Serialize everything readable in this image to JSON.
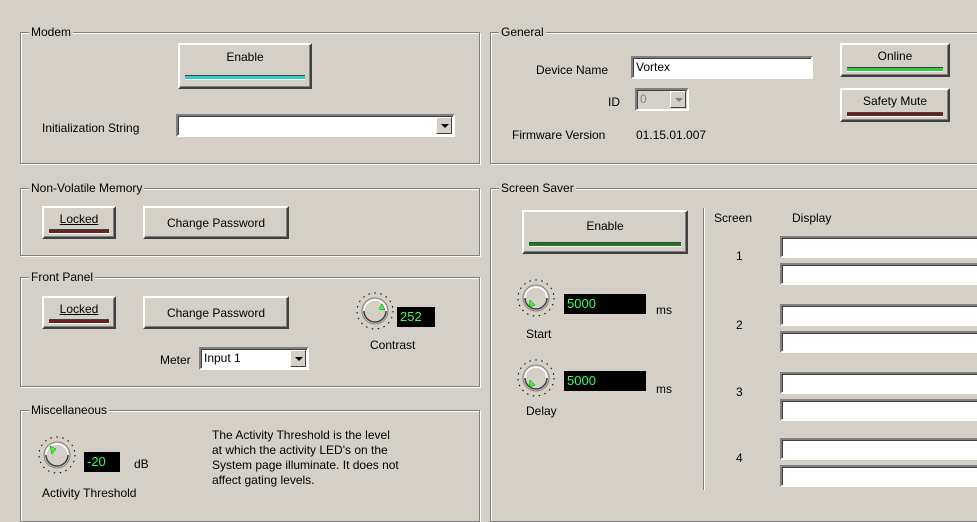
{
  "modem": {
    "title": "Modem",
    "enable_label": "Enable",
    "init_label": "Initialization String",
    "init_value": ""
  },
  "nvm": {
    "title": "Non-Volatile Memory",
    "locked_label": "Locked",
    "change_password_label": "Change Password"
  },
  "front_panel": {
    "title": "Front Panel",
    "locked_label": "Locked",
    "change_password_label": "Change Password",
    "contrast_value": "252",
    "contrast_label": "Contrast",
    "meter_label": "Meter",
    "meter_value": "Input 1"
  },
  "misc": {
    "title": "Miscellaneous",
    "threshold_value": "-20",
    "threshold_unit": "dB",
    "threshold_label": "Activity Threshold",
    "description_lines": [
      "The Activity Threshold is the level",
      "at which the activity LED's on the",
      "System page illuminate. It does not",
      "affect gating levels."
    ]
  },
  "general": {
    "title": "General",
    "device_name_label": "Device Name",
    "device_name_value": "Vortex",
    "id_label": "ID",
    "id_value": "0",
    "firmware_label": "Firmware Version",
    "firmware_value": "01.15.01.007",
    "online_label": "Online",
    "safety_mute_label": "Safety Mute"
  },
  "screen_saver": {
    "title": "Screen Saver",
    "enable_label": "Enable",
    "start_value": "5000",
    "start_unit": "ms",
    "start_label": "Start",
    "delay_value": "5000",
    "delay_unit": "ms",
    "delay_label": "Delay",
    "screen_header": "Screen",
    "display_header": "Display",
    "screens": [
      {
        "number": "1",
        "line1": "",
        "line2": ""
      },
      {
        "number": "2",
        "line1": "",
        "line2": ""
      },
      {
        "number": "3",
        "line1": "",
        "line2": ""
      },
      {
        "number": "4",
        "line1": "",
        "line2": ""
      }
    ]
  },
  "colors": {
    "background": "#d4d0c8",
    "modem_enable_bar": "#33cccc",
    "locked_bar": "#6b1f1f",
    "online_bar": "#33cc33",
    "safety_mute_bar": "#6b1f1f",
    "screensaver_enable_bar": "#1f7a1f",
    "lcd_text": "#33ff66",
    "knob_indicator": "#33ff33"
  }
}
